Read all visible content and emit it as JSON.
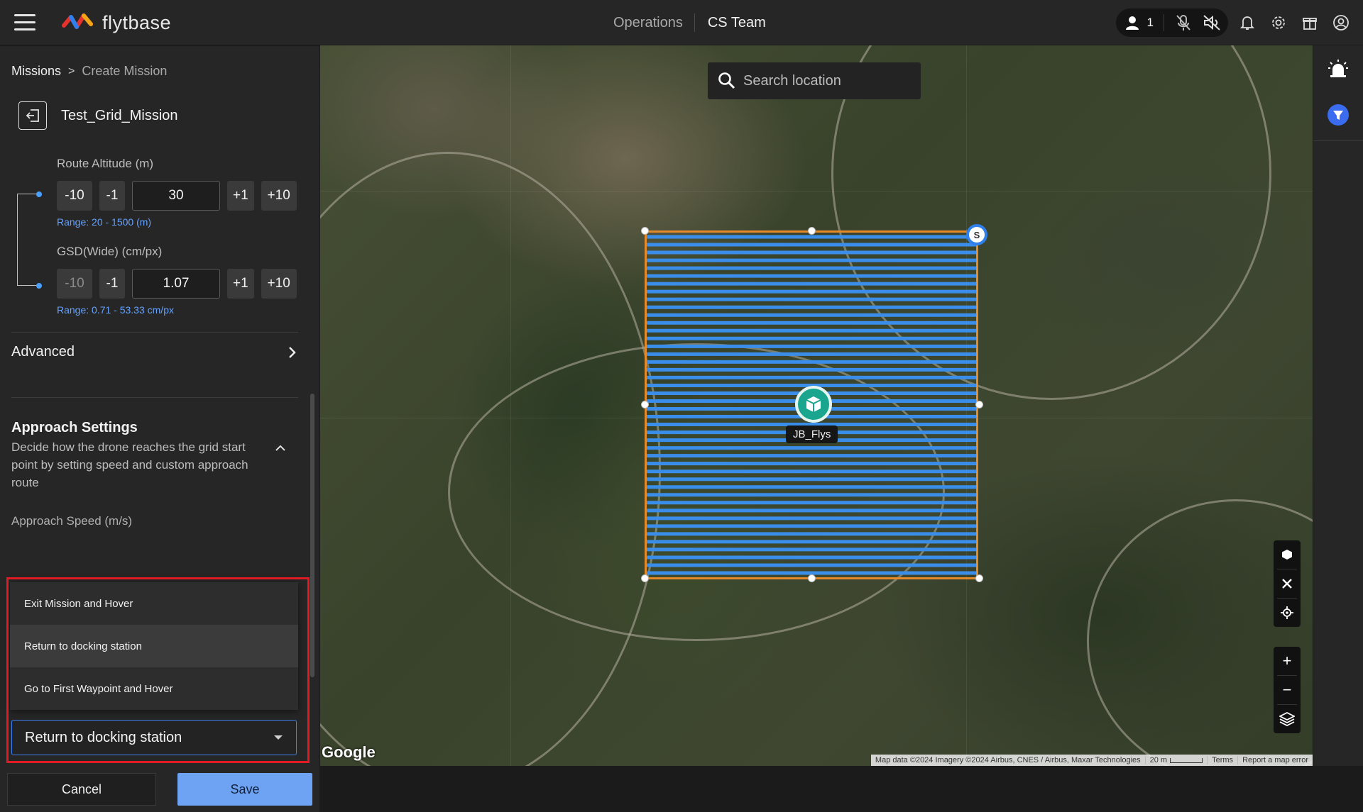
{
  "app": {
    "brand": "flytbase"
  },
  "topbar": {
    "nav_operations": "Operations",
    "nav_team": "CS Team",
    "user_count": "1"
  },
  "panel": {
    "breadcrumb": {
      "root": "Missions",
      "separator": ">",
      "current": "Create Mission"
    },
    "mission_name": "Test_Grid_Mission",
    "route_altitude": {
      "label": "Route Altitude (m)",
      "buttons": [
        "-10",
        "-1",
        "+1",
        "+10"
      ],
      "value": "30",
      "range": "Range: 20 - 1500 (m)"
    },
    "gsd": {
      "label": "GSD(Wide) (cm/px)",
      "buttons": [
        "-10",
        "-1",
        "+1",
        "+10"
      ],
      "value": "1.07",
      "range": "Range: 0.71 - 53.33 cm/px"
    },
    "advanced_label": "Advanced",
    "approach": {
      "title": "Approach Settings",
      "description": "Decide how the drone reaches the grid start point by setting speed and custom approach route",
      "speed_label": "Approach Speed (m/s)"
    },
    "dropdown": {
      "options": [
        "Exit Mission and Hover",
        "Return to docking station",
        "Go to First Waypoint and Hover"
      ],
      "selected": "Return to docking station"
    },
    "footer": {
      "cancel": "Cancel",
      "save": "Save"
    }
  },
  "map": {
    "search_placeholder": "Search location",
    "start_marker_label": "S",
    "dock_label": "JB_Flys",
    "google_label": "Google",
    "attribution": {
      "data": "Map data ©2024 Imagery ©2024 Airbus, CNES / Airbus, Maxar Technologies",
      "scale": "20 m",
      "terms": "Terms",
      "report": "Report a map error"
    },
    "controls_top": [
      "cube-icon",
      "collapse-icon",
      "locate-icon"
    ],
    "controls_bottom": [
      "+",
      "−",
      "layers-icon"
    ]
  },
  "colors": {
    "accent": "#3b82f6",
    "save_button": "#6ea2f3",
    "grid_line": "#3a8eea",
    "grid_border": "#e48a2a",
    "dock": "#1aa68e",
    "highlight": "#e01b24"
  }
}
